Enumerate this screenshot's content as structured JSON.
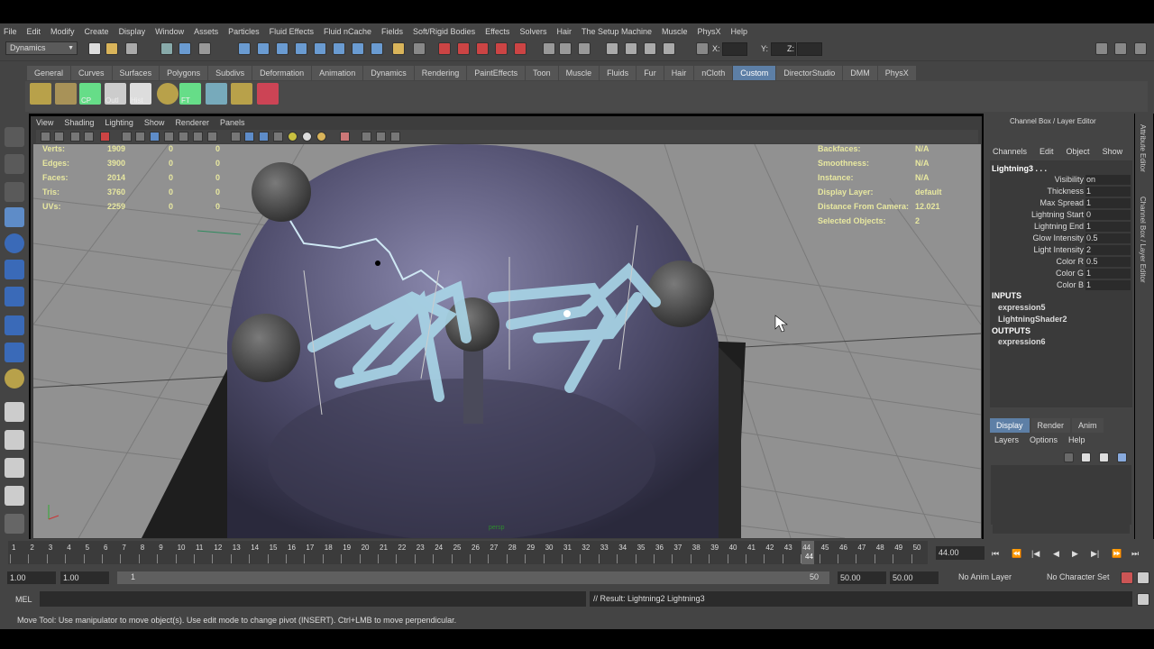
{
  "menus": [
    "File",
    "Edit",
    "Modify",
    "Create",
    "Display",
    "Window",
    "Assets",
    "Particles",
    "Fluid Effects",
    "Fluid nCache",
    "Fields",
    "Soft/Rigid Bodies",
    "Effects",
    "Solvers",
    "Hair",
    "The Setup Machine",
    "Muscle",
    "PhysX",
    "Help"
  ],
  "status": {
    "mode": "Dynamics",
    "x_label": "X:",
    "y_label": "Y:",
    "z_label": "Z:"
  },
  "shelf_tabs": [
    "General",
    "Curves",
    "Surfaces",
    "Polygons",
    "Subdivs",
    "Deformation",
    "Animation",
    "Dynamics",
    "Rendering",
    "PaintEffects",
    "Toon",
    "Muscle",
    "Fluids",
    "Fur",
    "Hair",
    "nCloth",
    "Custom",
    "DirectorStudio",
    "DMM",
    "PhysX"
  ],
  "shelf_active": "Custom",
  "shelf_labels": {
    "cp": "CP",
    "outl": "Outl",
    "hist": "Hist",
    "ft": "FT"
  },
  "panel_menu": [
    "View",
    "Shading",
    "Lighting",
    "Show",
    "Renderer",
    "Panels"
  ],
  "hud_left": [
    {
      "label": "Verts:",
      "v": "1909",
      "a": "0",
      "b": "0"
    },
    {
      "label": "Edges:",
      "v": "3900",
      "a": "0",
      "b": "0"
    },
    {
      "label": "Faces:",
      "v": "2014",
      "a": "0",
      "b": "0"
    },
    {
      "label": "Tris:",
      "v": "3760",
      "a": "0",
      "b": "0"
    },
    {
      "label": "UVs:",
      "v": "2259",
      "a": "0",
      "b": "0"
    }
  ],
  "hud_right": [
    {
      "label": "Backfaces:",
      "v": "N/A"
    },
    {
      "label": "Smoothness:",
      "v": "N/A"
    },
    {
      "label": "Instance:",
      "v": "N/A"
    },
    {
      "label": "Display Layer:",
      "v": "default"
    },
    {
      "label": "Distance From Camera:",
      "v": "12.021"
    },
    {
      "label": "Selected Objects:",
      "v": "2"
    }
  ],
  "camera_label": "persp",
  "channel_box": {
    "title": "Channel Box / Layer Editor",
    "menu": [
      "Channels",
      "Edit",
      "Object",
      "Show"
    ],
    "object": "Lightning3 . . .",
    "channels": [
      {
        "name": "Visibility",
        "value": "on"
      },
      {
        "name": "Thickness",
        "value": "1"
      },
      {
        "name": "Max Spread",
        "value": "1"
      },
      {
        "name": "Lightning Start",
        "value": "0"
      },
      {
        "name": "Lightning End",
        "value": "1"
      },
      {
        "name": "Glow Intensity",
        "value": "0.5"
      },
      {
        "name": "Light Intensity",
        "value": "2"
      },
      {
        "name": "Color R",
        "value": "0.5"
      },
      {
        "name": "Color G",
        "value": "1"
      },
      {
        "name": "Color B",
        "value": "1"
      }
    ],
    "inputs_label": "INPUTS",
    "inputs": [
      "expression5",
      "LightningShader2"
    ],
    "outputs_label": "OUTPUTS",
    "outputs": [
      "expression6"
    ]
  },
  "layer_editor": {
    "tabs": [
      "Display",
      "Render",
      "Anim"
    ],
    "active": "Display",
    "menu": [
      "Layers",
      "Options",
      "Help"
    ]
  },
  "edge_tabs": [
    "Attribute Editor",
    "Channel Box / Layer Editor"
  ],
  "timeline": {
    "ticks": [
      "1",
      "2",
      "3",
      "4",
      "5",
      "6",
      "7",
      "8",
      "9",
      "10",
      "11",
      "12",
      "13",
      "14",
      "15",
      "16",
      "17",
      "18",
      "19",
      "20",
      "21",
      "22",
      "23",
      "24",
      "25",
      "26",
      "27",
      "28",
      "29",
      "30",
      "31",
      "32",
      "33",
      "34",
      "35",
      "36",
      "37",
      "38",
      "39",
      "40",
      "41",
      "42",
      "43",
      "44",
      "45",
      "46",
      "47",
      "48",
      "49",
      "50"
    ],
    "current": "44",
    "current_field": "44.00"
  },
  "range": {
    "start": "1.00",
    "start2": "1.00",
    "slider_start": "1",
    "slider_end": "50",
    "end": "50.00",
    "end2": "50.00",
    "anim_layer": "No Anim Layer",
    "char_set": "No Character Set"
  },
  "command": {
    "label": "MEL",
    "result": "// Result: Lightning2 Lightning3"
  },
  "help_line": "Move Tool: Use manipulator to move object(s). Use edit mode to change pivot (INSERT).  Ctrl+LMB to move perpendicular."
}
